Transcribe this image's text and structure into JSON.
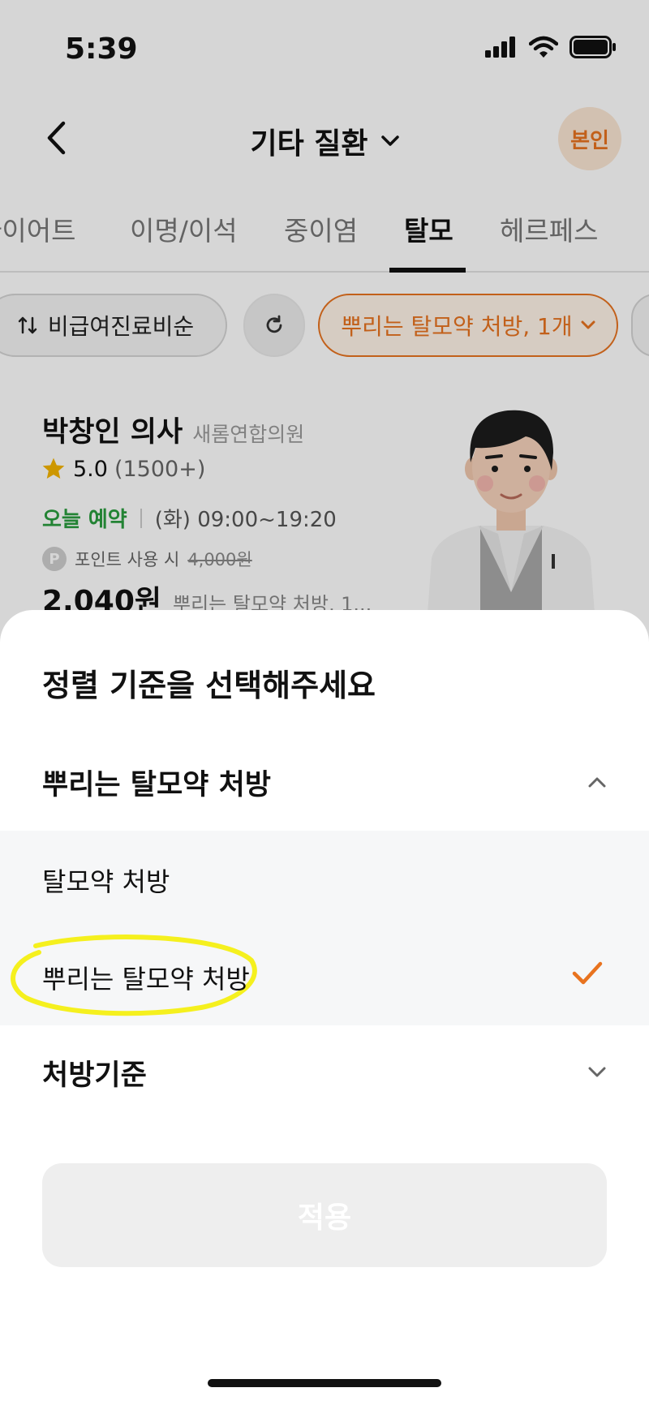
{
  "status_bar": {
    "time": "5:39",
    "icons": [
      "signal-icon",
      "wifi-icon",
      "battery-icon"
    ]
  },
  "header": {
    "title": "기타 질환",
    "profile_label": "본인"
  },
  "tabs": [
    {
      "label": "다이어트",
      "active": false
    },
    {
      "label": "이명/이석",
      "active": false
    },
    {
      "label": "중이염",
      "active": false
    },
    {
      "label": "탈모",
      "active": true
    },
    {
      "label": "헤르페스",
      "active": false
    }
  ],
  "filters": {
    "sort_label": "비급여진료비순",
    "filter_label": "뿌리는 탈모약 처방, 1개"
  },
  "doctor": {
    "name": "박창인 의사",
    "clinic": "새롬연합의원",
    "rating": "5.0",
    "rating_count": "(1500+)",
    "today_label": "오늘 예약",
    "hours": "(화) 09:00~19:20",
    "point_icon_letter": "P",
    "point_label": "포인트 사용 시",
    "original_price": "4,000원",
    "price": "2,040원",
    "prescription": "뿌리는 탈모약 처방, 1..."
  },
  "sheet": {
    "title": "정렬 기준을 선택해주세요",
    "section1": {
      "label": "뿌리는 탈모약 처방",
      "expanded": true,
      "options": [
        {
          "label": "탈모약 처방",
          "selected": false
        },
        {
          "label": "뿌리는 탈모약 처방",
          "selected": true
        }
      ]
    },
    "section2": {
      "label": "처방기준",
      "expanded": false
    },
    "apply_label": "적용"
  },
  "colors": {
    "accent": "#e8731f",
    "today_green": "#2a9d3f",
    "highlight_yellow": "#f5f01e",
    "sheet_option_bg": "#f6f7f8"
  }
}
